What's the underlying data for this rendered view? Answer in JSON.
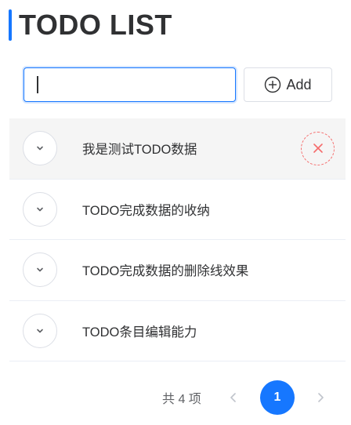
{
  "header": {
    "title": "TODO LIST",
    "accent_color": "#1677ff"
  },
  "input": {
    "value": "",
    "placeholder": ""
  },
  "add_button": {
    "label": "Add",
    "icon": "plus-circle-icon"
  },
  "todos": [
    {
      "text": "我是测试TODO数据",
      "hovered": true
    },
    {
      "text": "TODO完成数据的收纳",
      "hovered": false
    },
    {
      "text": "TODO完成数据的删除线效果",
      "hovered": false
    },
    {
      "text": "TODO条目编辑能力",
      "hovered": false
    }
  ],
  "delete_icon": "close-icon",
  "pagination": {
    "total_text": "共 4 项",
    "current_page": "1",
    "prev_icon": "chevron-left-icon",
    "next_icon": "chevron-right-icon"
  },
  "colors": {
    "primary": "#1677ff",
    "danger": "#f56c6c",
    "text": "#303133",
    "border": "#dcdfe6",
    "hover_bg": "#f5f5f5"
  }
}
